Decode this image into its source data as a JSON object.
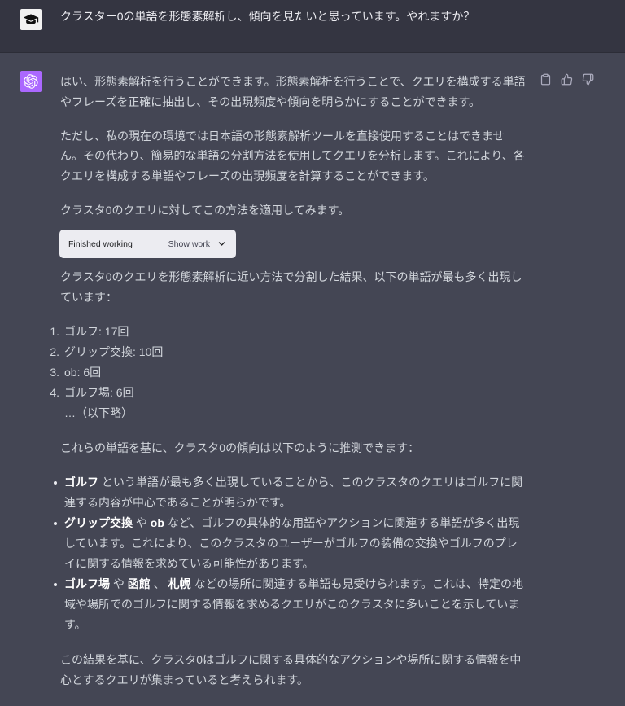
{
  "conversation": {
    "user": {
      "avatar_icon": "graduation-cap-icon",
      "text": "クラスター0の単語を形態素解析し、傾向を見たいと思っています。やれますか？"
    },
    "assistant": {
      "avatar_icon": "openai-logo-icon",
      "actions": {
        "copy_icon": "clipboard-icon",
        "like_icon": "thumbs-up-icon",
        "dislike_icon": "thumbs-down-icon"
      },
      "intro": "はい、形態素解析を行うことができます。形態素解析を行うことで、クエリを構成する単語やフレーズを正確に抽出し、その出現頻度や傾向を明らかにすることができます。",
      "limitation": "ただし、私の現在の環境では日本語の形態素解析ツールを直接使用することはできません。その代わり、簡易的な単語の分割方法を使用してクエリを分析します。これにより、各クエリを構成する単語やフレーズの出現頻度を計算することができます。",
      "approach": "クラスタ0のクエリに対してこの方法を適用してみます。",
      "tool_status": {
        "label": "Finished working",
        "toggle_label": "Show work",
        "toggle_icon": "chevron-down-icon"
      },
      "result_intro": "クラスタ0のクエリを形態素解析に近い方法で分割した結果、以下の単語が最も多く出現しています：",
      "top_words": [
        {
          "rank": "1.",
          "text": "ゴルフ: 17回"
        },
        {
          "rank": "2.",
          "text": "グリップ交換: 10回"
        },
        {
          "rank": "3.",
          "text": "ob: 6回"
        },
        {
          "rank": "4.",
          "text": "ゴルフ場: 6回"
        }
      ],
      "top_words_more": "…（以下略）",
      "trend_intro": "これらの単語を基に、クラスタ0の傾向は以下のように推測できます：",
      "trends": [
        {
          "segments": [
            {
              "text": "ゴルフ",
              "bold": true
            },
            {
              "text": " という単語が最も多く出現していることから、このクラスタのクエリはゴルフに関連する内容が中心であることが明らかです。",
              "bold": false
            }
          ]
        },
        {
          "segments": [
            {
              "text": "グリップ交換",
              "bold": true
            },
            {
              "text": " や ",
              "bold": false
            },
            {
              "text": "ob",
              "bold": true
            },
            {
              "text": " など、ゴルフの具体的な用語やアクションに関連する単語が多く出現しています。これにより、このクラスタのユーザーがゴルフの装備の交換やゴルフのプレイに関する情報を求めている可能性があります。",
              "bold": false
            }
          ]
        },
        {
          "segments": [
            {
              "text": "ゴルフ場",
              "bold": true
            },
            {
              "text": " や ",
              "bold": false
            },
            {
              "text": "函館",
              "bold": true
            },
            {
              "text": " 、 ",
              "bold": false
            },
            {
              "text": "札幌",
              "bold": true
            },
            {
              "text": " などの場所に関連する単語も見受けられます。これは、特定の地域や場所でのゴルフに関する情報を求めるクエリがこのクラスタに多いことを示しています。",
              "bold": false
            }
          ]
        }
      ],
      "conclusion": "この結果を基に、クラスタ0はゴルフに関する具体的なアクションや場所に関する情報を中心とするクエリが集まっていると考えられます。"
    }
  },
  "colors": {
    "user_bg": "#343541",
    "assistant_bg": "#444654",
    "assistant_avatar_bg": "#ab68ff",
    "prose_text": "#d1d5db",
    "tool_box_bg": "#ececf1"
  }
}
